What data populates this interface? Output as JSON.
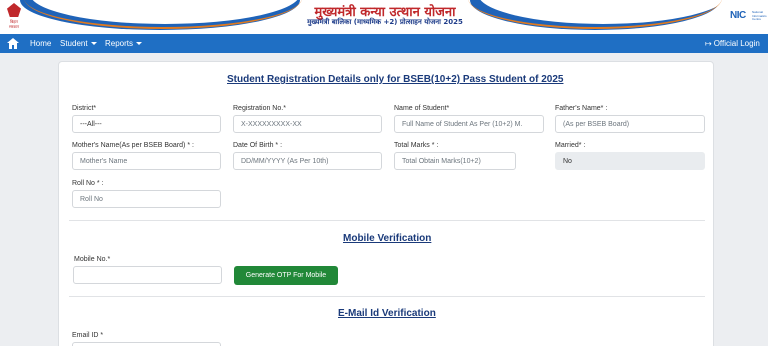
{
  "header": {
    "emblem_text": "बिहार सरकार",
    "title": "मुख्यमंत्री कन्या उत्थान योजना",
    "subtitle": "मुख्यमंत्री बालिका (माध्यमिक +2) प्रोत्साहन योजना 2025",
    "nic_logo": "NIC",
    "nic_subtext": "National Informatics Centre"
  },
  "navbar": {
    "home": "Home",
    "student": "Student",
    "reports": "Reports",
    "login": "Official Login",
    "icons": {
      "home": "home-icon",
      "login": "sign-in-icon",
      "dropdown": "caret-down-icon"
    }
  },
  "form": {
    "title": "Student Registration Details only for BSEB(10+2) Pass Student of 2025",
    "district": {
      "label": "District*",
      "value": "---All---"
    },
    "registration": {
      "label": "Registration No.*",
      "placeholder": "X-XXXXXXXXX-XX"
    },
    "student_name": {
      "label": "Name of Student*",
      "placeholder": "Full Name of Student As Per (10+2) M."
    },
    "father_name": {
      "label": "Father's Name* :",
      "placeholder": "(As per BSEB Board)"
    },
    "mother_name": {
      "label": "Mother's Name(As per BSEB Board) * :",
      "placeholder": "Mother's Name"
    },
    "dob": {
      "label": "Date Of Birth * :",
      "placeholder": "DD/MM/YYYY (As Per 10th)"
    },
    "total_marks": {
      "label": "Total Marks * :",
      "placeholder": "Total Obtain Marks(10+2)"
    },
    "married": {
      "label": "Married* :",
      "value": "No"
    },
    "roll_no": {
      "label": "Roll No * :",
      "placeholder": "Roll No"
    }
  },
  "mobile": {
    "title": "Mobile Verification",
    "label": "Mobile No.*",
    "button": "Generate OTP For Mobile"
  },
  "email": {
    "title": "E-Mail Id Verification",
    "label": "Email ID *"
  },
  "colors": {
    "navbar": "#1f6fc4",
    "title_red": "#c0282b",
    "section_title": "#1a3a7a",
    "otp_button": "#218838"
  }
}
